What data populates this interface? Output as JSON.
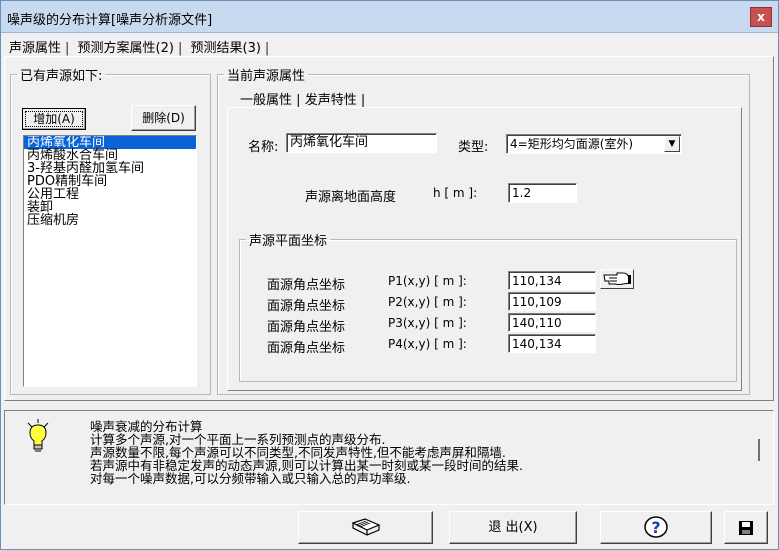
{
  "window": {
    "title": "噪声级的分布计算[噪声分析源文件]",
    "close_label": "x"
  },
  "tabs": [
    {
      "label": "声源属性"
    },
    {
      "label": "预测方案属性(2)"
    },
    {
      "label": "预测结果(3)"
    }
  ],
  "sources_group": {
    "legend": "已有声源如下:",
    "add_label": "增加(A)",
    "delete_label": "删除(D)",
    "items": [
      "丙烯氧化车间",
      "丙烯酸水合车间",
      "3-羟基丙醛加氢车间",
      "PDO精制车间",
      "公用工程",
      "装卸",
      "压缩机房"
    ],
    "selected_index": 0
  },
  "props_group": {
    "legend": "当前声源属性",
    "inner_tabs": [
      {
        "label": "一般属性"
      },
      {
        "label": "发声特性"
      }
    ],
    "name_label": "名称:",
    "name_value": "丙烯氧化车间",
    "type_label": "类型:",
    "type_value": "4=矩形均匀面源(室外)",
    "height_label": "声源离地面高度",
    "height_unit": "h [ m ]:",
    "height_value": "1.2",
    "coord_legend": "声源平面坐标",
    "corners": [
      {
        "label": "面源角点坐标",
        "unit": "P1(x,y) [ m ]:",
        "value": "110,134"
      },
      {
        "label": "面源角点坐标",
        "unit": "P2(x,y) [ m ]:",
        "value": "110,109"
      },
      {
        "label": "面源角点坐标",
        "unit": "P3(x,y) [ m ]:",
        "value": "140,110"
      },
      {
        "label": "面源角点坐标",
        "unit": "P4(x,y) [ m ]:",
        "value": "140,134"
      }
    ]
  },
  "info": {
    "lines": [
      "噪声衰减的分布计算",
      "计算多个声源,对一个平面上一系列预测点的声级分布.",
      "声源数量不限,每个声源可以不同类型,不同发声特性,但不能考虑声屏和隔墙.",
      "若声源中有非稳定发声的动态声源,则可以计算出某一时刻或某一段时间的结果.",
      "对每一个噪声数据,可以分频带输入或只输入总的声功率级."
    ]
  },
  "bottom": {
    "exit_label": "退 出(X)"
  },
  "icons": {
    "book": "book-icon",
    "help": "help-icon",
    "save": "floppy-disk-icon",
    "hand": "pointing-hand-icon",
    "bulb": "lightbulb-icon"
  }
}
